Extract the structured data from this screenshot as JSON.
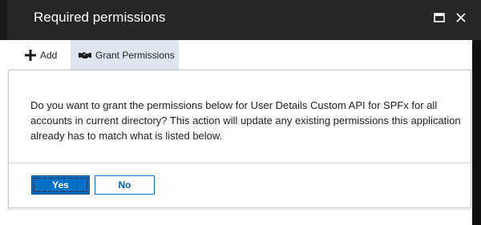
{
  "window": {
    "title": "Required permissions",
    "maximize_icon": "maximize-icon",
    "close_icon": "close-icon"
  },
  "toolbar": {
    "add_label": "Add",
    "add_icon": "plus-icon",
    "grant_label": "Grant Permissions",
    "grant_icon": "handshake-icon"
  },
  "dialog": {
    "message": "Do you want to grant the permissions below for User Details Custom API for SPFx for all accounts in current directory? This action will update any existing permissions this application already has to match what is listed below.",
    "yes_label": "Yes",
    "no_label": "No"
  },
  "colors": {
    "titlebar": "#262626",
    "accent": "#0072c6",
    "grant_highlight": "#dde6f0"
  }
}
